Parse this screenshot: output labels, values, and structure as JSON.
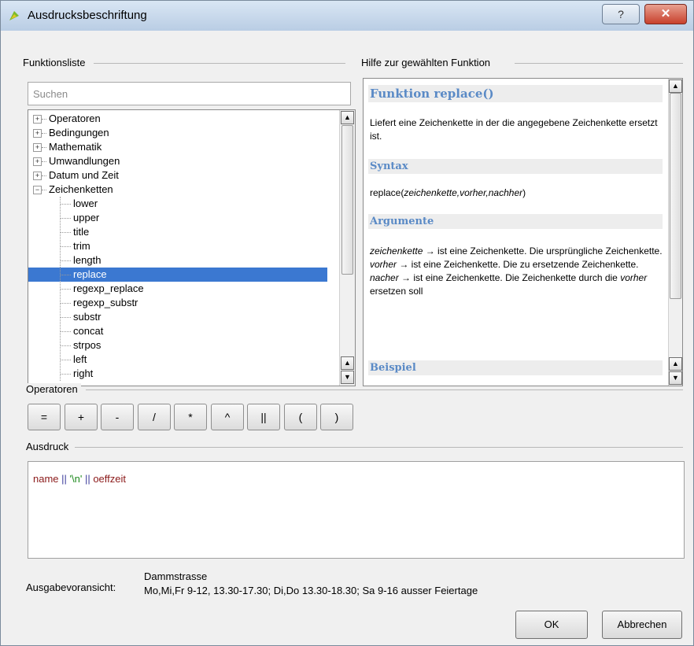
{
  "window": {
    "title": "Ausdrucksbeschriftung",
    "help_label": "?",
    "close_label": "✕"
  },
  "function_list": {
    "group_label": "Funktionsliste",
    "search_placeholder": "Suchen",
    "tree": [
      {
        "label": "Operatoren",
        "level": 0,
        "expander": "+"
      },
      {
        "label": "Bedingungen",
        "level": 0,
        "expander": "+"
      },
      {
        "label": "Mathematik",
        "level": 0,
        "expander": "+"
      },
      {
        "label": "Umwandlungen",
        "level": 0,
        "expander": "+"
      },
      {
        "label": "Datum und Zeit",
        "level": 0,
        "expander": "+"
      },
      {
        "label": "Zeichenketten",
        "level": 0,
        "expander": "−"
      },
      {
        "label": "lower",
        "level": 1
      },
      {
        "label": "upper",
        "level": 1
      },
      {
        "label": "title",
        "level": 1
      },
      {
        "label": "trim",
        "level": 1
      },
      {
        "label": "length",
        "level": 1
      },
      {
        "label": "replace",
        "level": 1,
        "selected": true
      },
      {
        "label": "regexp_replace",
        "level": 1
      },
      {
        "label": "regexp_substr",
        "level": 1
      },
      {
        "label": "substr",
        "level": 1
      },
      {
        "label": "concat",
        "level": 1
      },
      {
        "label": "strpos",
        "level": 1
      },
      {
        "label": "left",
        "level": 1
      },
      {
        "label": "right",
        "level": 1
      }
    ]
  },
  "help": {
    "group_label": "Hilfe zur gewählten Funktion",
    "title": "Funktion replace()",
    "description": "Liefert eine Zeichenkette in der die angegebene Zeichenkette ersetzt ist.",
    "syntax_heading": "Syntax",
    "syntax_fn": "replace(",
    "syntax_args": "zeichenkette,vorher,nachher",
    "syntax_close": ")",
    "arguments_heading": "Argumente",
    "arg1_name": "zeichenkette",
    "arg1_text": " → ist eine Zeichenkette. Die ursprüngliche Zeichenkette.",
    "arg2_name": "vorher",
    "arg2_text": " → ist eine Zeichenkette. Die zu ersetzende Zeichenkette.",
    "arg3_name": "nacher",
    "arg3_text": " → ist eine Zeichenkette. Die Zeichenkette durch die ",
    "arg3_name_inline": "vorher",
    "arg3_tail": " ersetzen soll",
    "example_heading": "Beispiel"
  },
  "operators": {
    "group_label": "Operatoren",
    "buttons": [
      "=",
      "+",
      "-",
      "/",
      "*",
      "^",
      "||",
      "(",
      ")"
    ]
  },
  "expression": {
    "group_label": "Ausdruck",
    "field1": "name",
    "op1": " || ",
    "string": "'\\n'",
    "op2": " || ",
    "field2": "oeffzeit"
  },
  "preview": {
    "label": "Ausgabevoransicht:",
    "line1": "Dammstrasse",
    "line2": "Mo,Mi,Fr 9-12, 13.30-17.30; Di,Do 13.30-18.30; Sa 9-16 ausser Feiertage"
  },
  "buttons": {
    "ok": "OK",
    "cancel": "Abbrechen"
  },
  "colors": {
    "selection": "#3b78d1",
    "help_heading": "#5a8ac6",
    "field": "#8b1a1a",
    "string": "#1e8a1e"
  }
}
